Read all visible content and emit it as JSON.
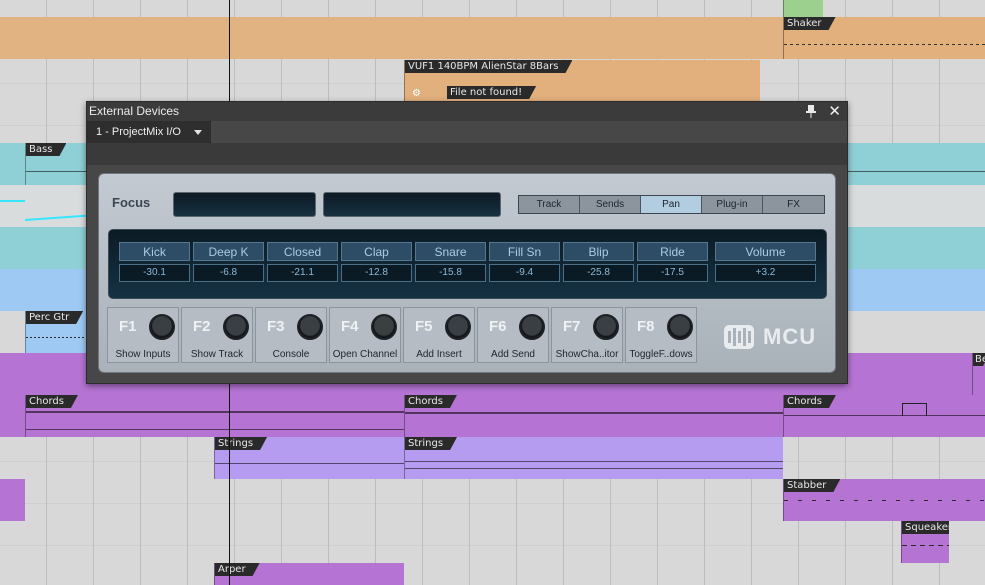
{
  "arrangement": {
    "clips": {
      "shaker": "Shaker",
      "loop": "VUF1 140BPM AlienStar 8Bars",
      "loop_status": "File not found!",
      "bass": "Bass",
      "perc_gtr": "Perc Gtr",
      "chords_1": "Chords",
      "chords_2": "Chords",
      "chords_3": "Chords",
      "strings_1": "Strings",
      "strings_2": "Strings",
      "stabber": "Stabber",
      "squeaker": "Squeaker",
      "arper": "Arper",
      "edge_tag": "Be"
    }
  },
  "window": {
    "title": "External Devices",
    "device_selector": "1 - ProjectMix I/O"
  },
  "mcu": {
    "focus_label": "Focus",
    "modes": [
      "Track",
      "Sends",
      "Pan",
      "Plug-in",
      "FX"
    ],
    "active_mode": "Pan",
    "channels": [
      {
        "name": "Kick",
        "value": "-30.1"
      },
      {
        "name": "Deep K",
        "value": "-6.8"
      },
      {
        "name": "Closed",
        "value": "-21.1"
      },
      {
        "name": "Clap",
        "value": "-12.8"
      },
      {
        "name": "Snare",
        "value": "-15.8"
      },
      {
        "name": "Fill Sn",
        "value": "-9.4"
      },
      {
        "name": "Blip",
        "value": "-25.8"
      },
      {
        "name": "Ride",
        "value": "-17.5"
      }
    ],
    "master": {
      "name": "Volume",
      "value": "+3.2"
    },
    "fkeys": [
      {
        "key": "F1",
        "label": "Show Inputs"
      },
      {
        "key": "F2",
        "label": "Show Track"
      },
      {
        "key": "F3",
        "label": "Console"
      },
      {
        "key": "F4",
        "label": "Open Channel"
      },
      {
        "key": "F5",
        "label": "Add Insert"
      },
      {
        "key": "F6",
        "label": "Add Send"
      },
      {
        "key": "F7",
        "label": "ShowCha..itor"
      },
      {
        "key": "F8",
        "label": "ToggleF..dows"
      }
    ],
    "logo_text": "MCU"
  },
  "colors": {
    "shaker_lane": "#e2b07d",
    "bass_lane": "#8fcfd6",
    "perc_lane": "#9ec9f2",
    "chords_lane": "#b574d3",
    "strings_lane": "#b59cf0",
    "active_mode": "#b3cde0",
    "lcd": "#0b1b25"
  }
}
